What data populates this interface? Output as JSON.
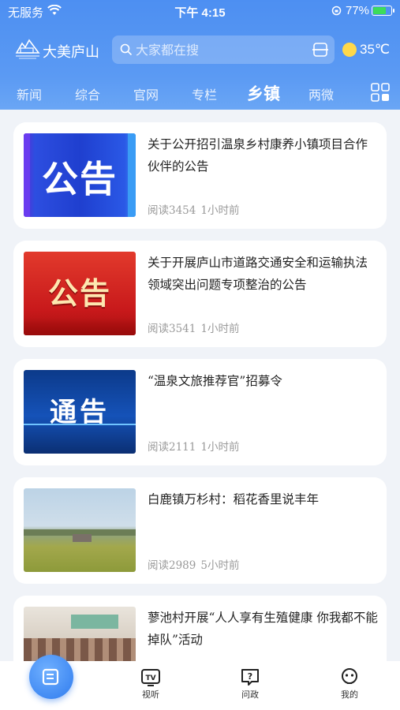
{
  "status_bar": {
    "carrier": "无服务",
    "time": "下午 4:15",
    "battery": "77%"
  },
  "header": {
    "brand": "大美庐山",
    "search_placeholder": "大家都在搜",
    "temperature": "35℃"
  },
  "tabs": [
    {
      "label": "新闻"
    },
    {
      "label": "综合"
    },
    {
      "label": "官网"
    },
    {
      "label": "专栏"
    },
    {
      "label": "乡镇",
      "active": true
    },
    {
      "label": "两微"
    }
  ],
  "articles": [
    {
      "title": "关于公开招引温泉乡村康养小镇项目合作伙伴的公告",
      "reads": "阅读3454",
      "time": "1小时前",
      "thumb_text": "公告"
    },
    {
      "title": "关于开展庐山市道路交通安全和运输执法领域突出问题专项整治的公告",
      "reads": "阅读3541",
      "time": "1小时前",
      "thumb_text": "公告"
    },
    {
      "title": "“温泉文旅推荐官”招募令",
      "reads": "阅读2111",
      "time": "1小时前",
      "thumb_text": "通告"
    },
    {
      "title": "白鹿镇万杉村：稻花香里说丰年",
      "reads": "阅读2989",
      "time": "5小时前"
    },
    {
      "title": "蓼池村开展“人人享有生殖健康 你我都不能掉队”活动"
    }
  ],
  "bottom_nav": [
    {
      "label": "视听",
      "icon": "tv-icon"
    },
    {
      "label": "问政",
      "icon": "question-icon"
    },
    {
      "label": "我的",
      "icon": "profile-icon"
    }
  ],
  "colors": {
    "header_blue": "#4d8ff2",
    "accent": "#2f7bee"
  }
}
